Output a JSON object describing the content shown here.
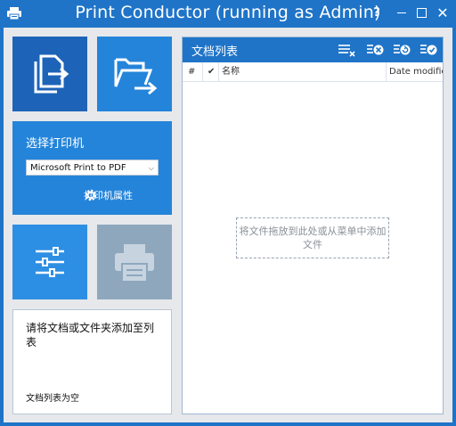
{
  "window": {
    "title": "Print Conductor (running as Admin)",
    "help_label": "?",
    "close_label": "✕"
  },
  "printer": {
    "label": "选择打印机",
    "selected": "Microsoft Print to PDF",
    "properties_label": "打印机属性"
  },
  "status": {
    "message": "请将文档或文件夹添加至列表",
    "empty_label": "文档列表为空"
  },
  "doc_list": {
    "title": "文档列表",
    "columns": {
      "hash": "#",
      "check": "✔",
      "name": "名称",
      "date": "Date modified"
    },
    "drop_hint": "将文件拖放到此处或从菜单中添加文件"
  },
  "icons": {
    "app": "printer-icon",
    "add_files": "add-documents-icon",
    "add_folder": "add-folder-icon",
    "settings": "sliders-icon",
    "print": "print-icon",
    "printer_properties": "gear-icon",
    "list_actions": [
      "clear-list-icon",
      "remove-item-icon",
      "refresh-icon",
      "check-icon"
    ]
  },
  "colors": {
    "accent": "#1f74c8",
    "tile_dark": "#1d64b8",
    "tile_medium": "#2484da",
    "tile_light": "#2d8fe3",
    "tile_disabled": "#8ea7bd",
    "background": "#e6e8eb"
  }
}
